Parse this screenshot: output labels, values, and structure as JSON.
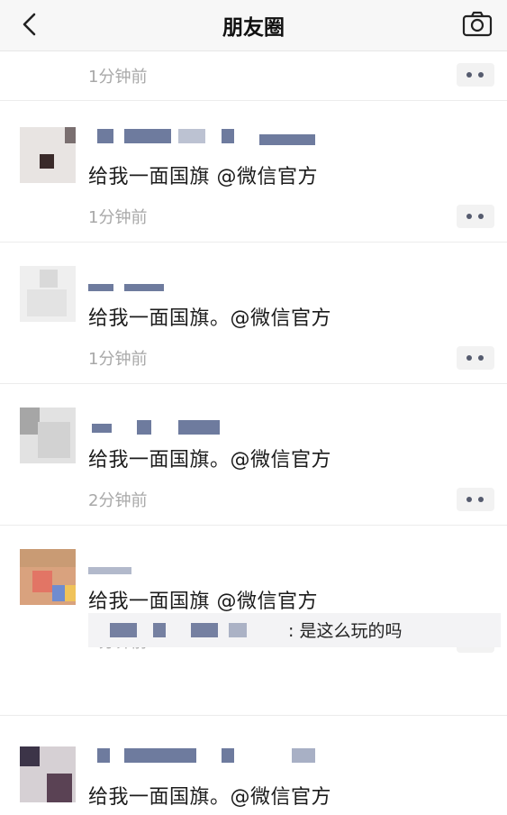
{
  "navbar": {
    "title": "朋友圈",
    "back_icon": "chevron-left-icon",
    "camera_icon": "camera-icon"
  },
  "posts": [
    {
      "time": "1分钟前"
    },
    {
      "text": "给我一面国旗 @微信官方",
      "time": "1分钟前"
    },
    {
      "text": "给我一面国旗。@微信官方",
      "time": "1分钟前"
    },
    {
      "text": "给我一面国旗。@微信官方",
      "time": "2分钟前"
    },
    {
      "text": "给我一面国旗 @微信官方",
      "time": "2分钟前",
      "comment": ": 是这么玩的吗"
    },
    {
      "text": "给我一面国旗。@微信官方"
    }
  ],
  "colors": {
    "name_blue": "#3e4f7e",
    "time_gray": "#a8a8a8",
    "nav_bg": "#f7f7f7"
  }
}
